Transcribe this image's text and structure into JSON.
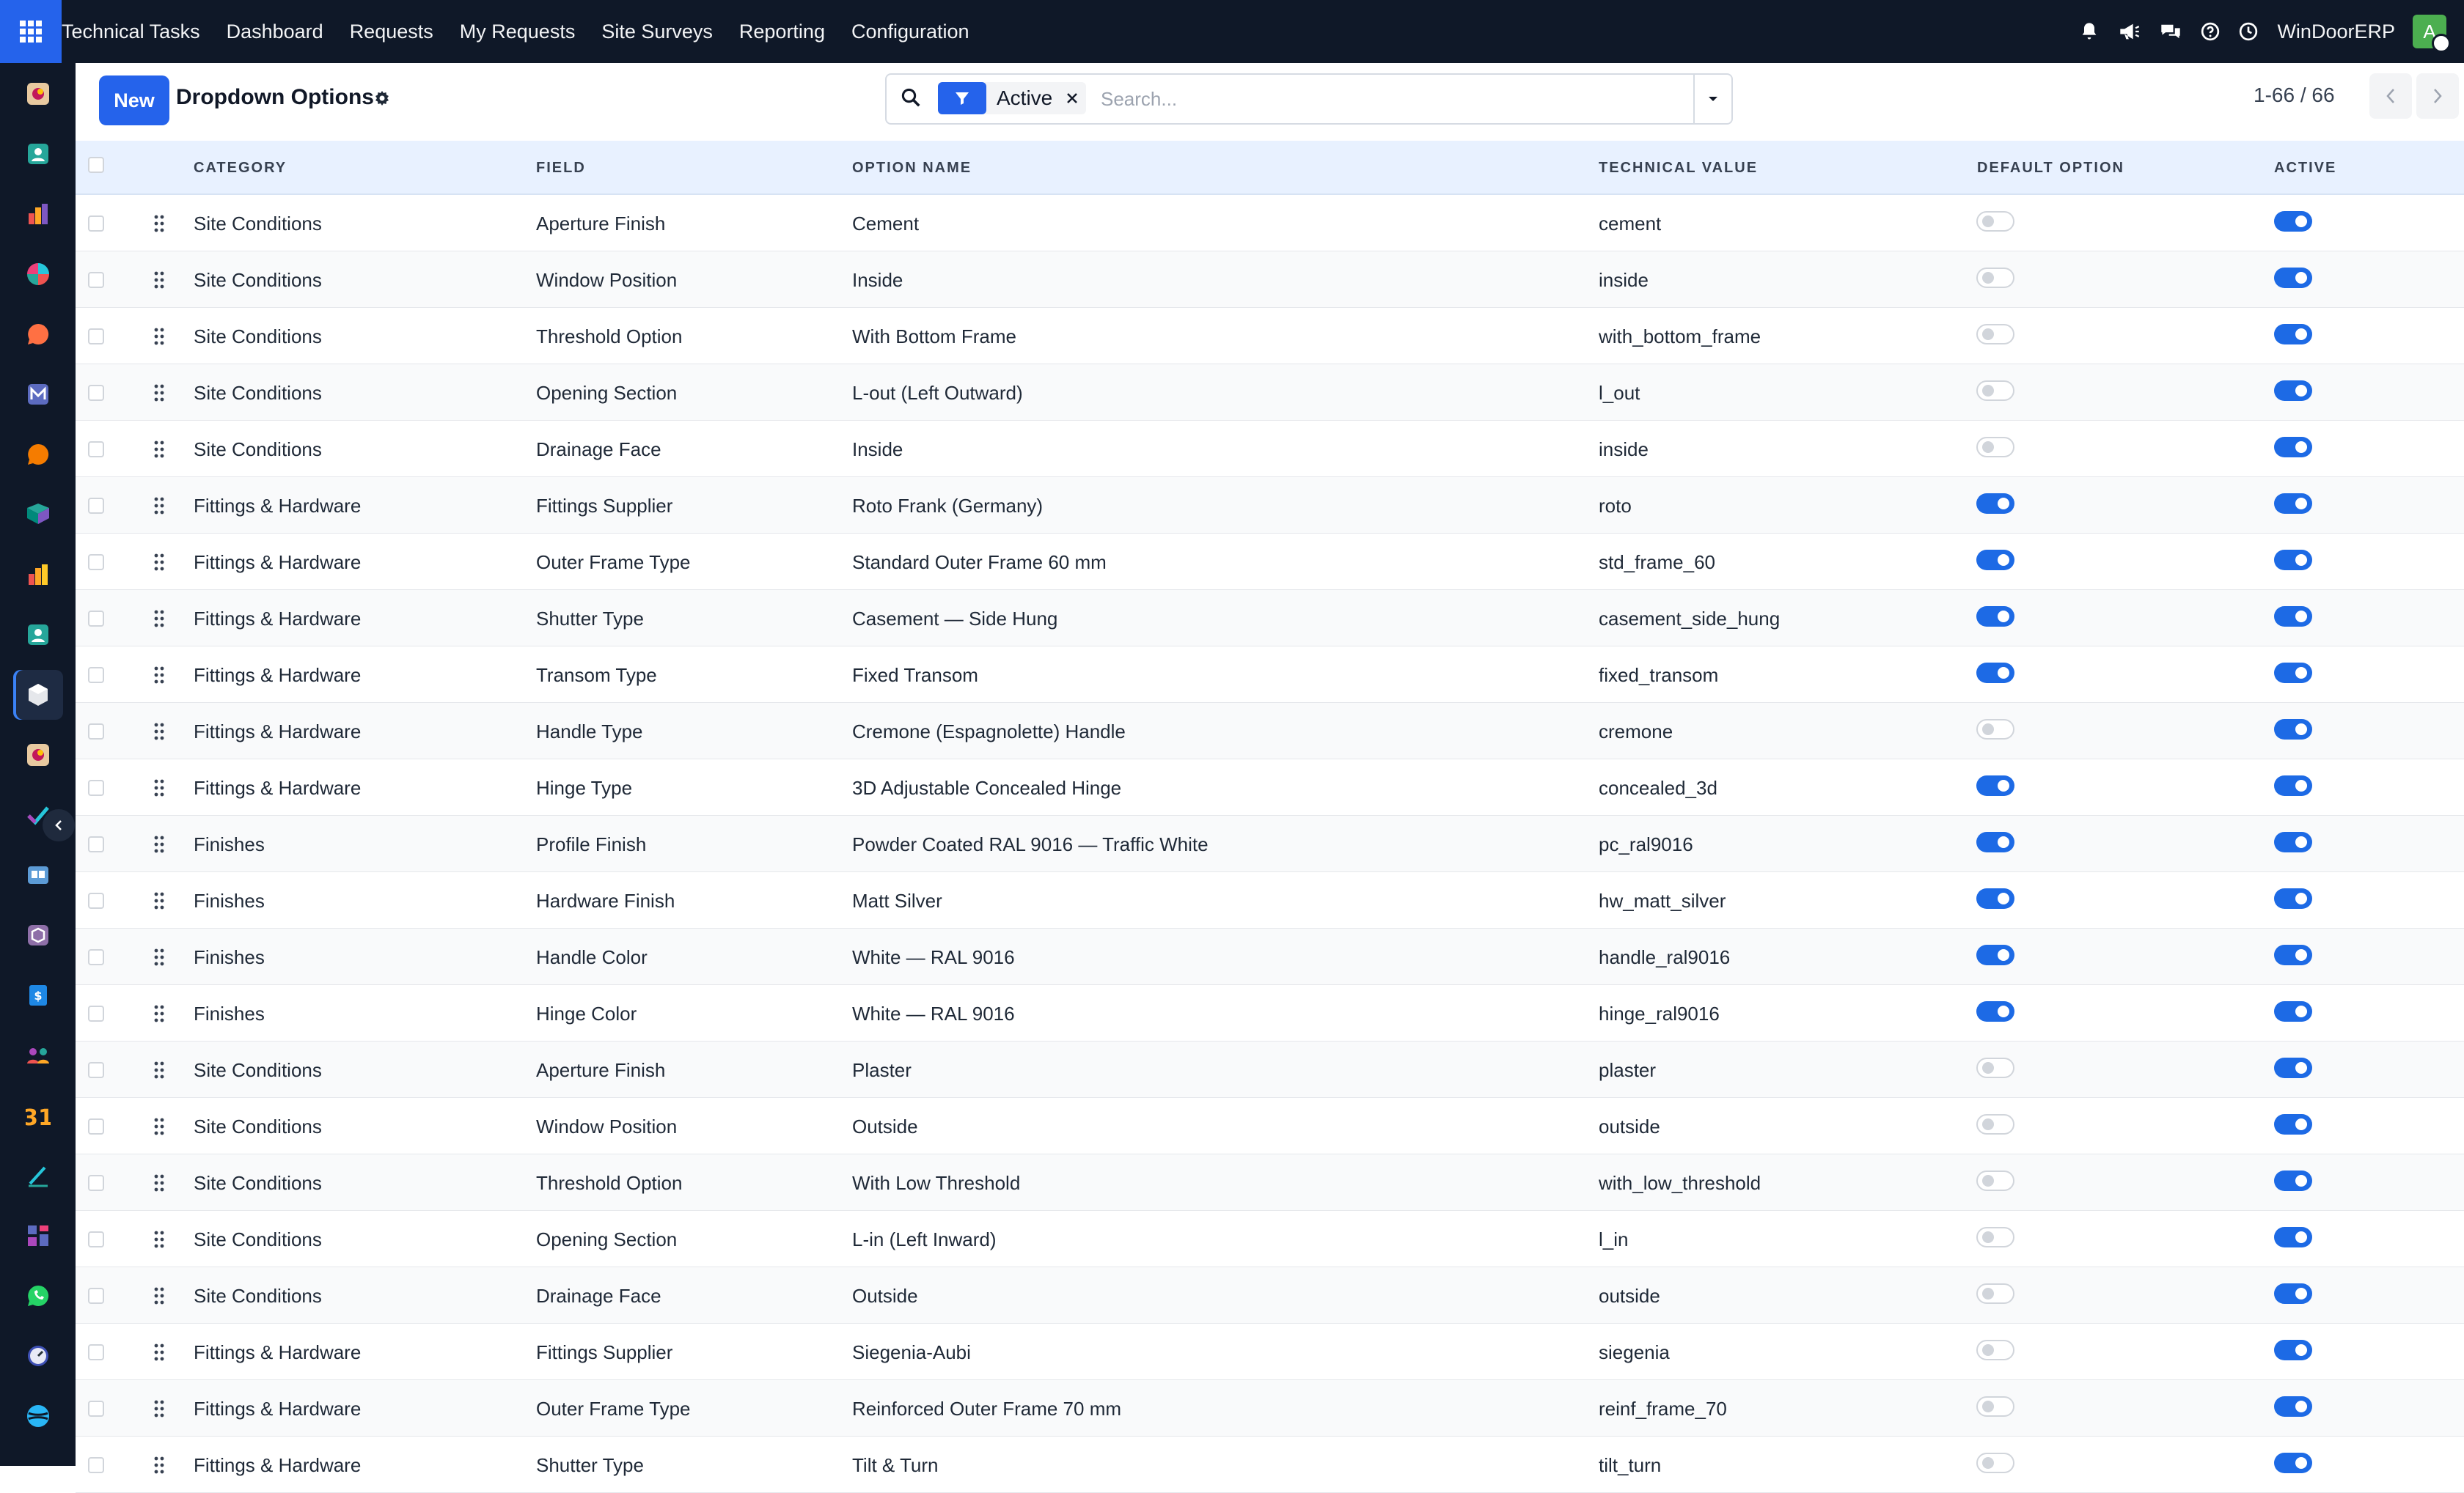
{
  "topbar": {
    "app_title": "Technical Tasks",
    "menu": [
      "Dashboard",
      "Requests",
      "My Requests",
      "Site Surveys",
      "Reporting",
      "Configuration"
    ],
    "company": "WinDoorERP",
    "avatar_initial": "A",
    "icons": [
      "bell-icon",
      "megaphone-icon",
      "chat-icon",
      "help-icon",
      "clock-icon"
    ]
  },
  "sidebar": {
    "apps": [
      "discuss",
      "contacts",
      "dashboards",
      "crm",
      "chat",
      "email-marketing",
      "live-chat",
      "inventory",
      "reporting",
      "employees",
      "technical-tasks",
      "project",
      "tasks",
      "knowledge",
      "packages",
      "invoicing",
      "team",
      "calendar",
      "sign",
      "spreadsheets",
      "whatsapp",
      "timer",
      "website"
    ],
    "active": "technical-tasks"
  },
  "control": {
    "new_label": "New",
    "title": "Dropdown Options",
    "filter_label": "Active",
    "search_placeholder": "Search...",
    "pager": "1-66 / 66"
  },
  "table": {
    "columns": [
      "CATEGORY",
      "FIELD",
      "OPTION NAME",
      "TECHNICAL VALUE",
      "DEFAULT OPTION",
      "ACTIVE"
    ],
    "rows": [
      {
        "category": "Site Conditions",
        "field": "Aperture Finish",
        "option": "Cement",
        "value": "cement",
        "default": false,
        "active": true
      },
      {
        "category": "Site Conditions",
        "field": "Window Position",
        "option": "Inside",
        "value": "inside",
        "default": false,
        "active": true
      },
      {
        "category": "Site Conditions",
        "field": "Threshold Option",
        "option": "With Bottom Frame",
        "value": "with_bottom_frame",
        "default": false,
        "active": true
      },
      {
        "category": "Site Conditions",
        "field": "Opening Section",
        "option": "L-out (Left Outward)",
        "value": "l_out",
        "default": false,
        "active": true
      },
      {
        "category": "Site Conditions",
        "field": "Drainage Face",
        "option": "Inside",
        "value": "inside",
        "default": false,
        "active": true
      },
      {
        "category": "Fittings & Hardware",
        "field": "Fittings Supplier",
        "option": "Roto Frank (Germany)",
        "value": "roto",
        "default": true,
        "active": true
      },
      {
        "category": "Fittings & Hardware",
        "field": "Outer Frame Type",
        "option": "Standard Outer Frame 60 mm",
        "value": "std_frame_60",
        "default": true,
        "active": true
      },
      {
        "category": "Fittings & Hardware",
        "field": "Shutter Type",
        "option": "Casement — Side Hung",
        "value": "casement_side_hung",
        "default": true,
        "active": true
      },
      {
        "category": "Fittings & Hardware",
        "field": "Transom Type",
        "option": "Fixed Transom",
        "value": "fixed_transom",
        "default": true,
        "active": true
      },
      {
        "category": "Fittings & Hardware",
        "field": "Handle Type",
        "option": "Cremone (Espagnolette) Handle",
        "value": "cremone",
        "default": false,
        "active": true
      },
      {
        "category": "Fittings & Hardware",
        "field": "Hinge Type",
        "option": "3D Adjustable Concealed Hinge",
        "value": "concealed_3d",
        "default": true,
        "active": true
      },
      {
        "category": "Finishes",
        "field": "Profile Finish",
        "option": "Powder Coated RAL 9016 — Traffic White",
        "value": "pc_ral9016",
        "default": true,
        "active": true
      },
      {
        "category": "Finishes",
        "field": "Hardware Finish",
        "option": "Matt Silver",
        "value": "hw_matt_silver",
        "default": true,
        "active": true
      },
      {
        "category": "Finishes",
        "field": "Handle Color",
        "option": "White — RAL 9016",
        "value": "handle_ral9016",
        "default": true,
        "active": true
      },
      {
        "category": "Finishes",
        "field": "Hinge Color",
        "option": "White — RAL 9016",
        "value": "hinge_ral9016",
        "default": true,
        "active": true
      },
      {
        "category": "Site Conditions",
        "field": "Aperture Finish",
        "option": "Plaster",
        "value": "plaster",
        "default": false,
        "active": true
      },
      {
        "category": "Site Conditions",
        "field": "Window Position",
        "option": "Outside",
        "value": "outside",
        "default": false,
        "active": true
      },
      {
        "category": "Site Conditions",
        "field": "Threshold Option",
        "option": "With Low Threshold",
        "value": "with_low_threshold",
        "default": false,
        "active": true
      },
      {
        "category": "Site Conditions",
        "field": "Opening Section",
        "option": "L-in (Left Inward)",
        "value": "l_in",
        "default": false,
        "active": true
      },
      {
        "category": "Site Conditions",
        "field": "Drainage Face",
        "option": "Outside",
        "value": "outside",
        "default": false,
        "active": true
      },
      {
        "category": "Fittings & Hardware",
        "field": "Fittings Supplier",
        "option": "Siegenia-Aubi",
        "value": "siegenia",
        "default": false,
        "active": true
      },
      {
        "category": "Fittings & Hardware",
        "field": "Outer Frame Type",
        "option": "Reinforced Outer Frame 70 mm",
        "value": "reinf_frame_70",
        "default": false,
        "active": true
      },
      {
        "category": "Fittings & Hardware",
        "field": "Shutter Type",
        "option": "Tilt & Turn",
        "value": "tilt_turn",
        "default": false,
        "active": true
      }
    ]
  },
  "colors": {
    "topbar_bg": "#0f1828",
    "accent": "#2563eb",
    "toggle_on": "#1d6ae5",
    "header_bg": "#e8f1ff"
  }
}
